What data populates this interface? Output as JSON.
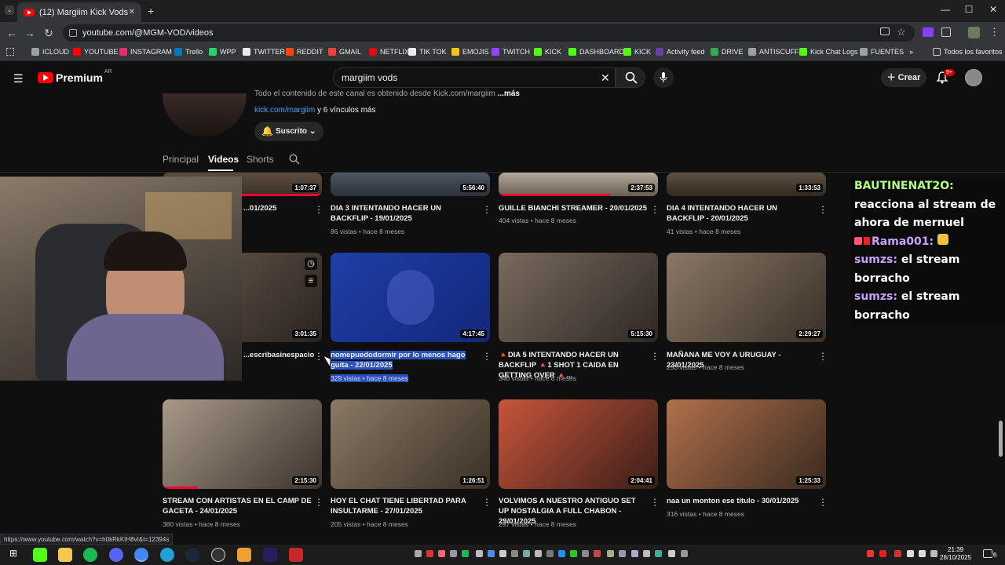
{
  "browser": {
    "tab_title": "(12) Margiim Kick Vods - YouTube",
    "new_tab_label": "+",
    "url": "youtube.com/@MGM-VOD/videos",
    "window_controls": [
      "—",
      "☐",
      "✕"
    ],
    "bookmarks": [
      {
        "label": "ICLOUD",
        "color": "#9aa0a6"
      },
      {
        "label": "YOUTUBE",
        "color": "#ff0000"
      },
      {
        "label": "INSTAGRAM",
        "color": "#e1306c"
      },
      {
        "label": "Trello",
        "color": "#0079bf"
      },
      {
        "label": "WPP",
        "color": "#25d366"
      },
      {
        "label": "TWITTER",
        "color": "#e8eaed"
      },
      {
        "label": "REDDIT",
        "color": "#ff4500"
      },
      {
        "label": "GMAIL",
        "color": "#ea4335"
      },
      {
        "label": "NETFLIX",
        "color": "#e50914"
      },
      {
        "label": "TIK TOK",
        "color": "#e8eaed"
      },
      {
        "label": "EMOJIS",
        "color": "#f5c518"
      },
      {
        "label": "TWITCH",
        "color": "#9146ff"
      },
      {
        "label": "KICK",
        "color": "#53fc18"
      },
      {
        "label": "DASHBOARD",
        "color": "#53fc18"
      },
      {
        "label": "KICK",
        "color": "#53fc18"
      },
      {
        "label": "Activity feed",
        "color": "#6441a5"
      },
      {
        "label": "DRIVE",
        "color": "#34a853"
      },
      {
        "label": "ANTISCUFF",
        "color": "#9aa0a6"
      },
      {
        "label": "Kick Chat Logs",
        "color": "#53fc18"
      },
      {
        "label": "FUENTES",
        "color": "#9aa0a6"
      }
    ],
    "bookmarks_more": "»",
    "all_bookmarks": "Todos los favoritos",
    "status_url": "https://www.youtube.com/watch?v=h0kRkKIH8vI&t=12394s"
  },
  "youtube": {
    "logo_text": "Premium",
    "region": "AR",
    "search_query": "margiim vods",
    "create_label": "Crear",
    "notif_count": "9+"
  },
  "channel": {
    "description": "Todo el contenido de este canal es obtenido desde Kick.com/margiim",
    "more_label": "...más",
    "link_text": "kick.com/margiim",
    "link_more": "y 6 vínculos más",
    "subscribe_label": "Suscrito",
    "tabs": [
      "Principal",
      "Videos",
      "Shorts"
    ]
  },
  "videos": {
    "row1": [
      {
        "title": "...01/2025",
        "duration": "1:07:37",
        "meta": ""
      },
      {
        "title": "DIA 3 INTENTANDO HACER UN BACKFLIP - 19/01/2025",
        "duration": "5:56:40",
        "views": "86 vistas",
        "age": "hace 8 meses"
      },
      {
        "title": "GUILLE BIANCHI STREAMER - 20/01/2025",
        "duration": "2:37:53",
        "views": "404 vistas",
        "age": "hace 8 meses"
      },
      {
        "title": "DIA 4 INTENTANDO HACER UN BACKFLIP - 20/01/2025",
        "duration": "1:33:53",
        "views": "41 vistas",
        "age": "hace 8 meses"
      }
    ],
    "row2": [
      {
        "title": "...escribasinespacios...",
        "duration": "3:01:35"
      },
      {
        "title": "nomepuedodormir por lo menos hago guita - 22/01/2025",
        "duration": "4:17:45",
        "views": "329 vistas",
        "age": "hace 8 meses"
      },
      {
        "title": "🔺DIA 5 INTENTANDO HACER UN BACKFLIP 🔺1 SHOT 1 CAIDA EN GETTING OVER 🔺...",
        "duration": "5:15:30",
        "views": "340 vistas",
        "age": "hace 8 meses"
      },
      {
        "title": "MAÑANA ME VOY A URUGUAY - 23/01/2025",
        "duration": "2:29:27",
        "views": "253 vistas",
        "age": "hace 8 meses"
      }
    ],
    "row3": [
      {
        "title": "STREAM CON ARTISTAS EN EL CAMP DE GACETA - 24/01/2025",
        "duration": "2:15:30",
        "views": "380 vistas",
        "age": "hace 8 meses"
      },
      {
        "title": "HOY EL CHAT TIENE LIBERTAD PARA INSULTARME - 27/01/2025",
        "duration": "1:26:51",
        "views": "205 vistas",
        "age": "hace 8 meses"
      },
      {
        "title": "VOLVIMOS A NUESTRO ANTIGUO SET UP NOSTALGIA A FULL CHABON - 29/01/2025",
        "duration": "2:04:41",
        "views": "297 vistas",
        "age": "hace 8 meses"
      },
      {
        "title": "naa un monton ese titulo - 30/01/2025",
        "duration": "1:25:33",
        "views": "316 vistas",
        "age": "hace 8 meses"
      }
    ],
    "separator": "•"
  },
  "chat": {
    "lines": [
      {
        "user": "BAUTINENAT2O:",
        "msg": "reacciona al stream de ahora de mernuel"
      },
      {
        "user": "Rama001:",
        "msg": ""
      },
      {
        "user": "sumzs:",
        "msg": "el stream borracho"
      },
      {
        "user": "sumzs:",
        "msg": "el stream borracho"
      }
    ]
  },
  "taskbar": {
    "time": "21:39",
    "date": "28/10/2025",
    "notif": "6"
  }
}
